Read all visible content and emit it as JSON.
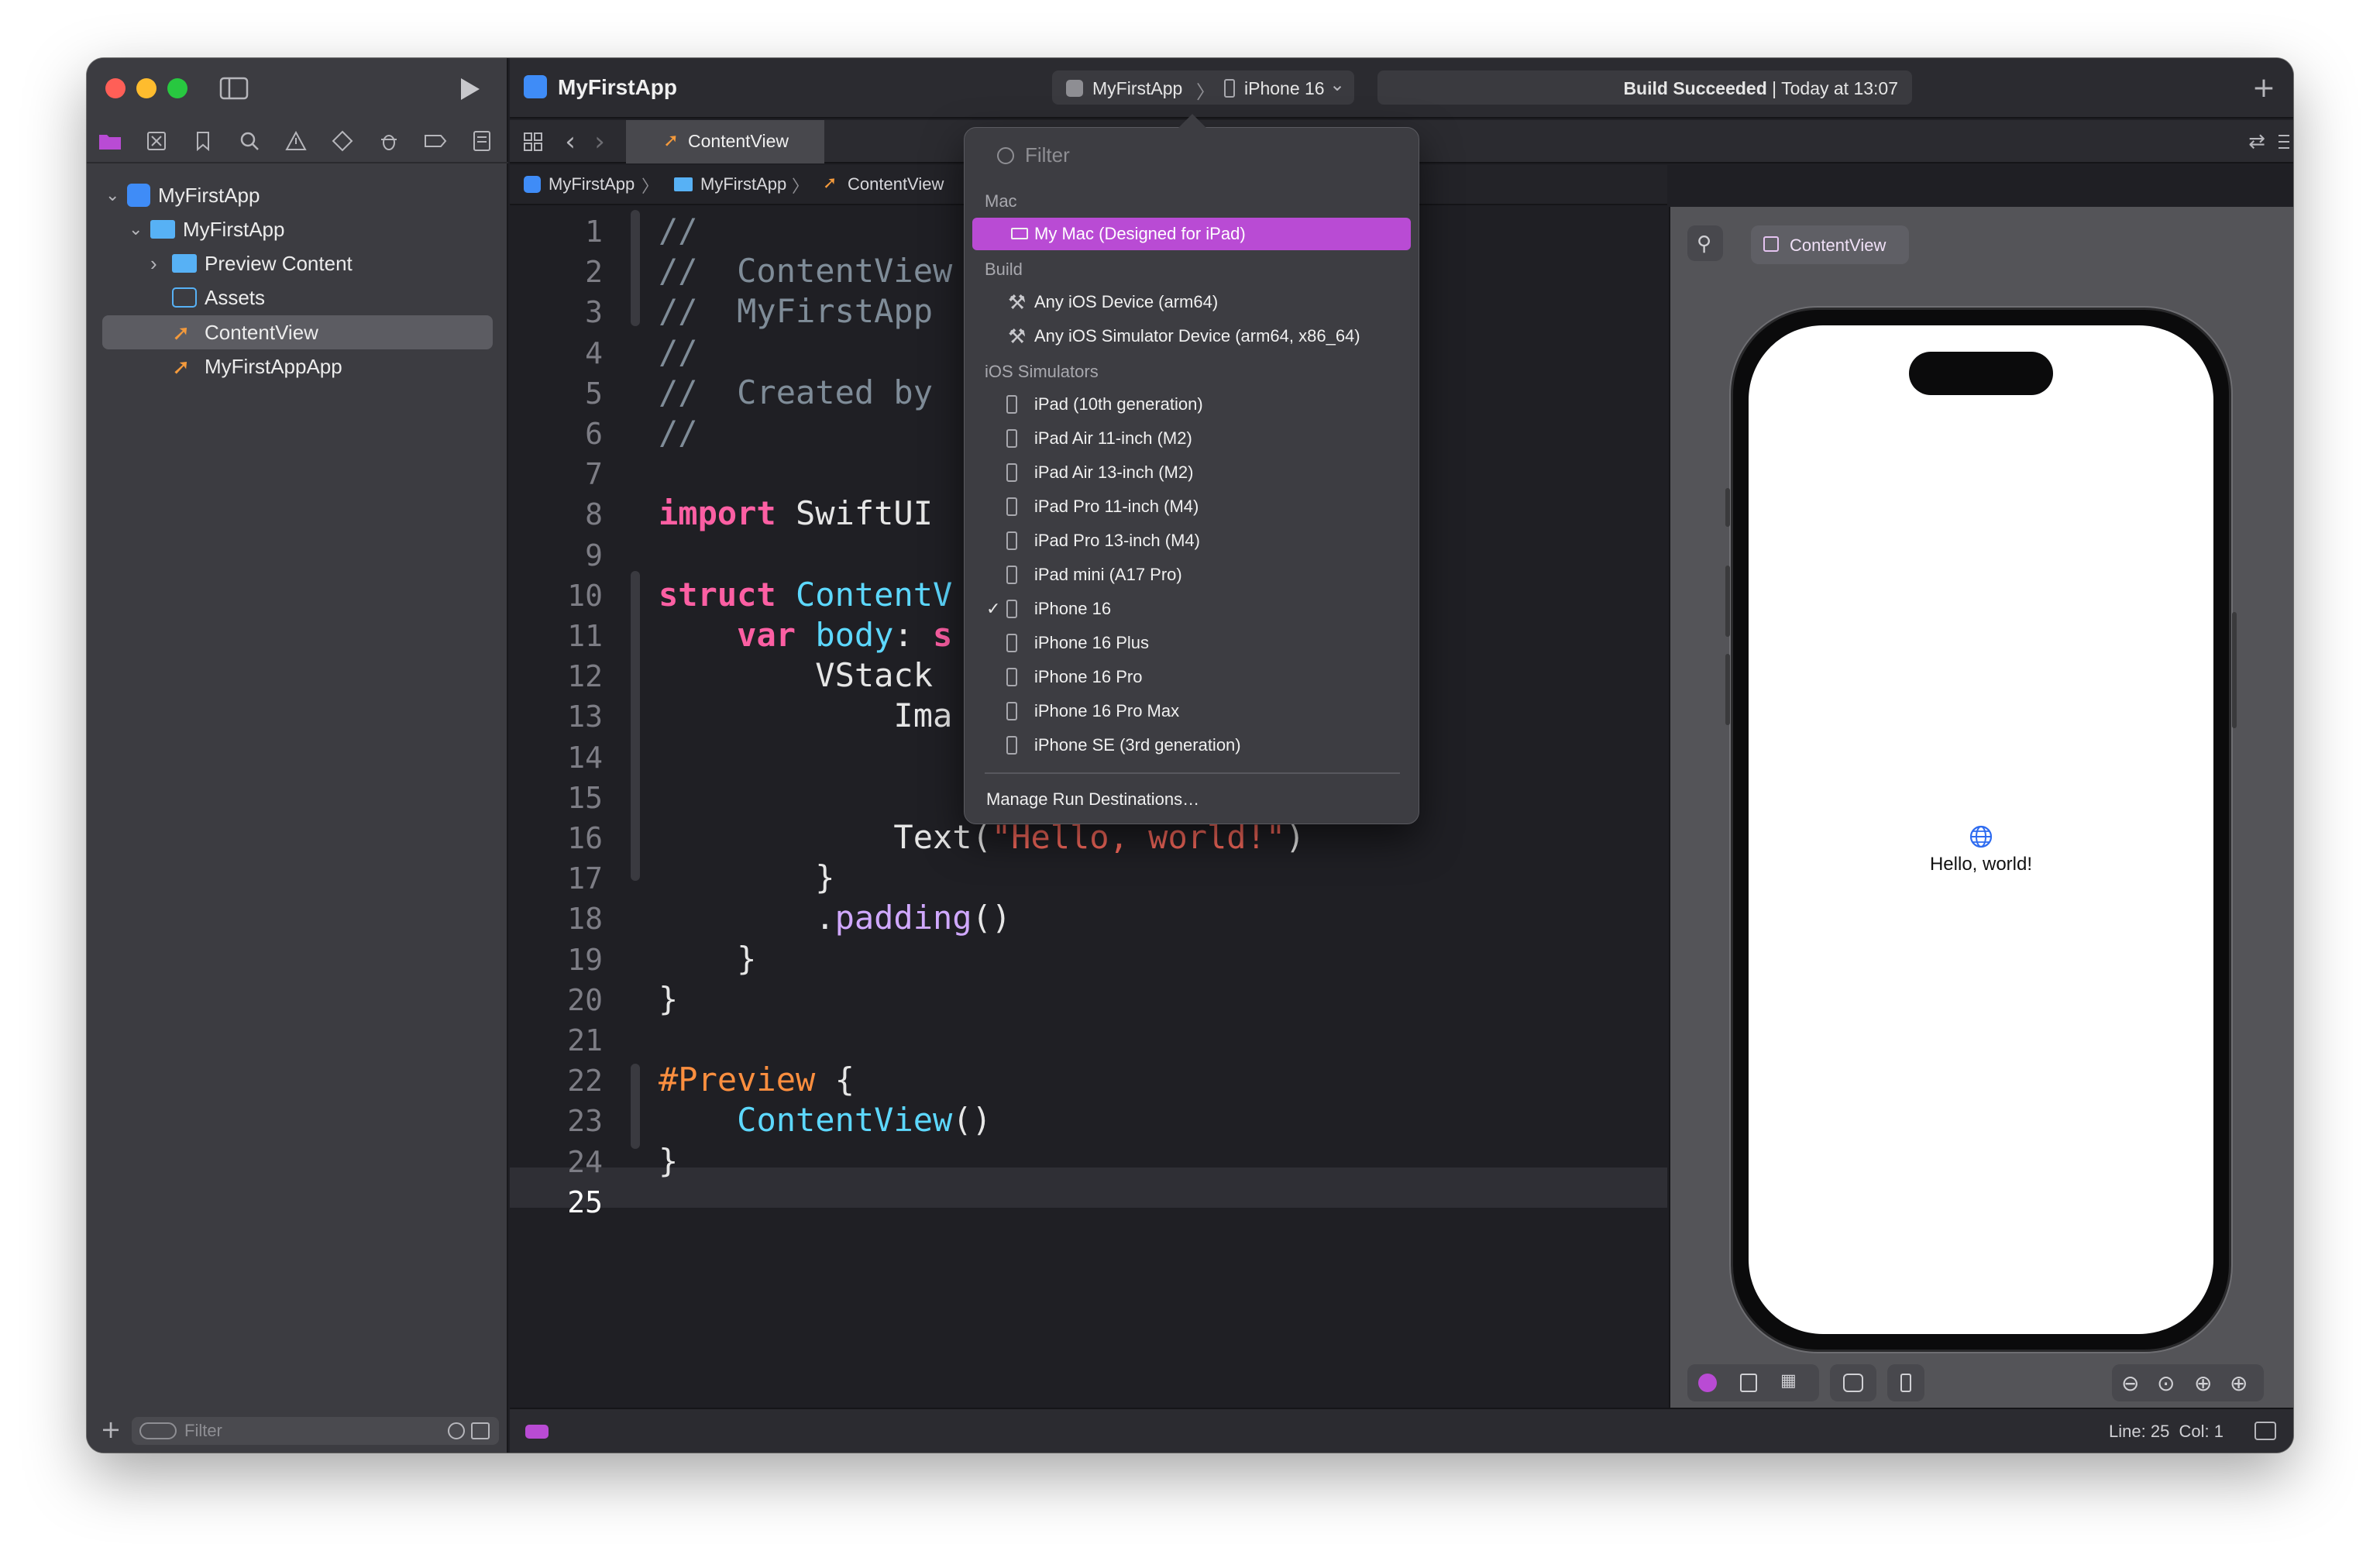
{
  "window": {
    "project_title": "MyFirstApp"
  },
  "toolbar": {
    "scheme": "MyFirstApp",
    "destination": "iPhone 16",
    "build_status_bold": "Build Succeeded",
    "build_status_rest": " | Today at 13:07"
  },
  "tabs": [
    {
      "label": "ContentView"
    }
  ],
  "jumpbar": [
    "MyFirstApp",
    "MyFirstApp",
    "ContentView"
  ],
  "navigator": {
    "items": [
      {
        "label": "MyFirstApp"
      },
      {
        "label": "MyFirstApp"
      },
      {
        "label": "Preview Content"
      },
      {
        "label": "Assets"
      },
      {
        "label": "ContentView"
      },
      {
        "label": "MyFirstAppApp"
      }
    ],
    "filter_placeholder": "Filter"
  },
  "editor": {
    "line_numbers": [
      "1",
      "2",
      "3",
      "4",
      "5",
      "6",
      "7",
      "8",
      "9",
      "10",
      "11",
      "12",
      "13",
      "14",
      "15",
      "16",
      "17",
      "18",
      "19",
      "20",
      "21",
      "22",
      "23",
      "24",
      "25"
    ],
    "lines": [
      [
        {
          "c": "c-com",
          "t": "//"
        }
      ],
      [
        {
          "c": "c-com",
          "t": "//  ContentView"
        }
      ],
      [
        {
          "c": "c-com",
          "t": "//  MyFirstApp"
        }
      ],
      [
        {
          "c": "c-com",
          "t": "//"
        }
      ],
      [
        {
          "c": "c-com",
          "t": "//  Created by"
        }
      ],
      [
        {
          "c": "c-com",
          "t": "//"
        }
      ],
      [],
      [
        {
          "c": "c-kw",
          "t": "import"
        },
        {
          "c": "c-plain",
          "t": " SwiftUI"
        }
      ],
      [],
      [
        {
          "c": "c-kw",
          "t": "struct"
        },
        {
          "c": "c-plain",
          "t": " "
        },
        {
          "c": "c-type",
          "t": "ContentV"
        }
      ],
      [
        {
          "c": "c-plain",
          "t": "    "
        },
        {
          "c": "c-kw",
          "t": "var"
        },
        {
          "c": "c-plain",
          "t": " "
        },
        {
          "c": "c-type",
          "t": "body"
        },
        {
          "c": "c-plain",
          "t": ": "
        },
        {
          "c": "c-kw",
          "t": "s"
        }
      ],
      [
        {
          "c": "c-plain",
          "t": "        VStack"
        }
      ],
      [
        {
          "c": "c-plain",
          "t": "            Ima"
        }
      ],
      [],
      [
        {
          "c": "c-plain",
          "t": "                                )"
        }
      ],
      [
        {
          "c": "c-plain",
          "t": "            Text("
        },
        {
          "c": "c-str",
          "t": "\"Hello, world!\""
        },
        {
          "c": "c-plain",
          "t": ")"
        }
      ],
      [
        {
          "c": "c-plain",
          "t": "        }"
        }
      ],
      [
        {
          "c": "c-plain",
          "t": "        ."
        },
        {
          "c": "c-fn",
          "t": "padding"
        },
        {
          "c": "c-plain",
          "t": "()"
        }
      ],
      [
        {
          "c": "c-plain",
          "t": "    }"
        }
      ],
      [
        {
          "c": "c-plain",
          "t": "}"
        }
      ],
      [],
      [
        {
          "c": "c-pp",
          "t": "#Preview"
        },
        {
          "c": "c-plain",
          "t": " {"
        }
      ],
      [
        {
          "c": "c-plain",
          "t": "    "
        },
        {
          "c": "c-type",
          "t": "ContentView"
        },
        {
          "c": "c-plain",
          "t": "()"
        }
      ],
      [
        {
          "c": "c-plain",
          "t": "}"
        }
      ],
      []
    ]
  },
  "menu": {
    "filter_placeholder": "Filter",
    "section_mac": "Mac",
    "mac_item": "My Mac (Designed for iPad)",
    "section_build": "Build",
    "build_items": [
      "Any iOS Device (arm64)",
      "Any iOS Simulator Device (arm64, x86_64)"
    ],
    "section_sim": "iOS Simulators",
    "sim_items": [
      "iPad (10th generation)",
      "iPad Air 11-inch (M2)",
      "iPad Air 13-inch (M2)",
      "iPad Pro 11-inch (M4)",
      "iPad Pro 13-inch (M4)",
      "iPad mini (A17 Pro)",
      "iPhone 16",
      "iPhone 16 Plus",
      "iPhone 16 Pro",
      "iPhone 16 Pro Max",
      "iPhone SE (3rd generation)"
    ],
    "checkmark": "✓",
    "manage": "Manage Run Destinations…"
  },
  "preview": {
    "pin_label": "ContentView",
    "hello": "Hello, world!"
  },
  "status": {
    "line_col": "Line: 25  Col: 1"
  },
  "colors": {
    "accent": "#b94bd4",
    "selected_row": "#5c5c62"
  }
}
